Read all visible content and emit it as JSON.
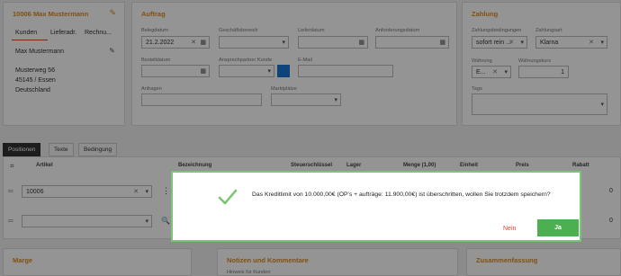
{
  "customer": {
    "title": "10006 Max Mustermann",
    "tabs": [
      "Kunden",
      "Lieferadr.",
      "Rechnu..."
    ],
    "name": "Max Mustermann",
    "street": "Musterweg 56",
    "city": "45145 / Essen",
    "country": "Deutschland"
  },
  "auftrag": {
    "title": "Auftrag",
    "belegdatum_label": "Belegdatum",
    "belegdatum_value": "21.2.2022",
    "geschaeftsbereich_label": "Geschäftsbereich",
    "lieferdatum_label": "Lieferdatum",
    "anforderungsdatum_label": "Anforderungsdatum",
    "bestelldatum_label": "Bestelldatum",
    "ansprechpartner_label": "Ansprechpartner Kunde",
    "email_label": "E-Mail",
    "anfragen_label": "Anfragen",
    "marktplaetze_label": "Marktplätze"
  },
  "zahlung": {
    "title": "Zahlung",
    "bedingungen_label": "Zahlungsbedingungen",
    "bedingungen_value": "sofort rein ...",
    "art_label": "Zahlungsart",
    "art_value": "Klarna",
    "waehrung_label": "Währung",
    "waehrung_value": "E...",
    "kurs_label": "Währungskurs",
    "kurs_value": "1",
    "tags_label": "Tags"
  },
  "tabs": [
    "Positionen",
    "Texte",
    "Bedingung"
  ],
  "columns": [
    "Artikel",
    "Bezeichnung",
    "Steuerschlüssel",
    "Lager",
    "Menge (1,00)",
    "Einheit",
    "Preis",
    "Rabatt"
  ],
  "row1_artikel": "10006",
  "row_values": [
    "0",
    "0"
  ],
  "bottom": {
    "marge": "Marge",
    "notizen": "Notizen und Kommentare",
    "hinweis": "Hinweis für Kunden",
    "zusammenfassung": "Zusammenfassung"
  },
  "dialog": {
    "message": "Das Kreditlimit von 10.000,00€ (OP's + aufträge: 11.900,00€) ist überschritten, wollen Sie trotzdem speichern?",
    "no_label": "Nein",
    "yes_label": "Ja"
  },
  "colors": {
    "accent": "#e08a1e",
    "primary_green": "#4caf50",
    "danger": "#e0432f"
  }
}
